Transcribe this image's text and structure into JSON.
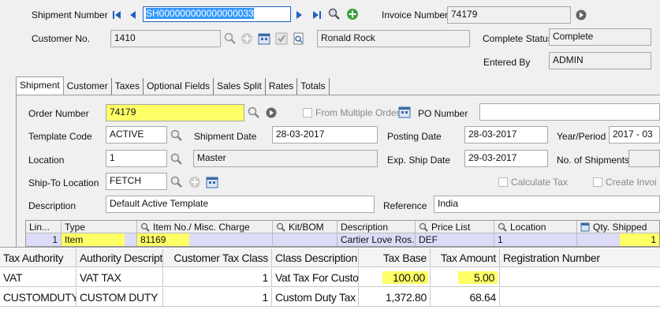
{
  "header": {
    "shipment_number_label": "Shipment Number",
    "shipment_number": "SH000000000000000033",
    "invoice_number_label": "Invoice Number",
    "invoice_number": "74179",
    "customer_no_label": "Customer No.",
    "customer_no": "1410",
    "customer_name": "Ronald Rock",
    "complete_status_label": "Complete Status",
    "complete_status": "Complete",
    "entered_by_label": "Entered By",
    "entered_by": "ADMIN"
  },
  "tabs": [
    "Shipment",
    "Customer",
    "Taxes",
    "Optional Fields",
    "Sales Split",
    "Rates",
    "Totals"
  ],
  "form": {
    "order_number_label": "Order Number",
    "order_number": "74179",
    "from_multiple_orders_label": "From Multiple Orders",
    "po_number_label": "PO Number",
    "po_number": "",
    "template_code_label": "Template Code",
    "template_code": "ACTIVE",
    "shipment_date_label": "Shipment Date",
    "shipment_date": "28-03-2017",
    "posting_date_label": "Posting Date",
    "posting_date": "28-03-2017",
    "year_period_label": "Year/Period",
    "year_period": "2017 - 03",
    "location_label": "Location",
    "location": "1",
    "location_desc": "Master",
    "exp_ship_date_label": "Exp. Ship Date",
    "exp_ship_date": "29-03-2017",
    "no_of_shipments_label": "No. of Shipments",
    "no_of_shipments": "",
    "ship_to_location_label": "Ship-To Location",
    "ship_to_location": "FETCH",
    "calculate_tax_label": "Calculate Tax",
    "create_invoice_label": "Create Invoi",
    "description_label": "Description",
    "description": "Default Active Template",
    "reference_label": "Reference",
    "reference": "India"
  },
  "lines_grid": {
    "headers": [
      "Lin...",
      "Type",
      "Item No./ Misc. Charge",
      "Kit/BOM",
      "Description",
      "Price List",
      "Location",
      "Qty. Shipped"
    ],
    "row": [
      "1",
      "Item",
      "81169",
      "",
      "Cartier Love Ros...",
      "DEF",
      "1",
      "1"
    ]
  },
  "tax_table": {
    "headers": [
      "Tax Authority",
      "Authority Description",
      "Customer Tax Class",
      "Class Description",
      "Tax Base",
      "Tax Amount",
      "Registration Number"
    ],
    "rows": [
      [
        "VAT",
        "VAT TAX",
        "1",
        "Vat Tax For Custo...",
        "100.00",
        "5.00",
        ""
      ],
      [
        "CUSTOMDUTY",
        "CUSTOM DUTY",
        "1",
        "Custom Duty Tax ...",
        "1,372.80",
        "68.64",
        ""
      ]
    ]
  },
  "colors": {
    "highlight": "#ffff66",
    "selected_row": "#dcdcf8",
    "nav_blue": "#2060c0",
    "add_green": "#3aa03a"
  }
}
